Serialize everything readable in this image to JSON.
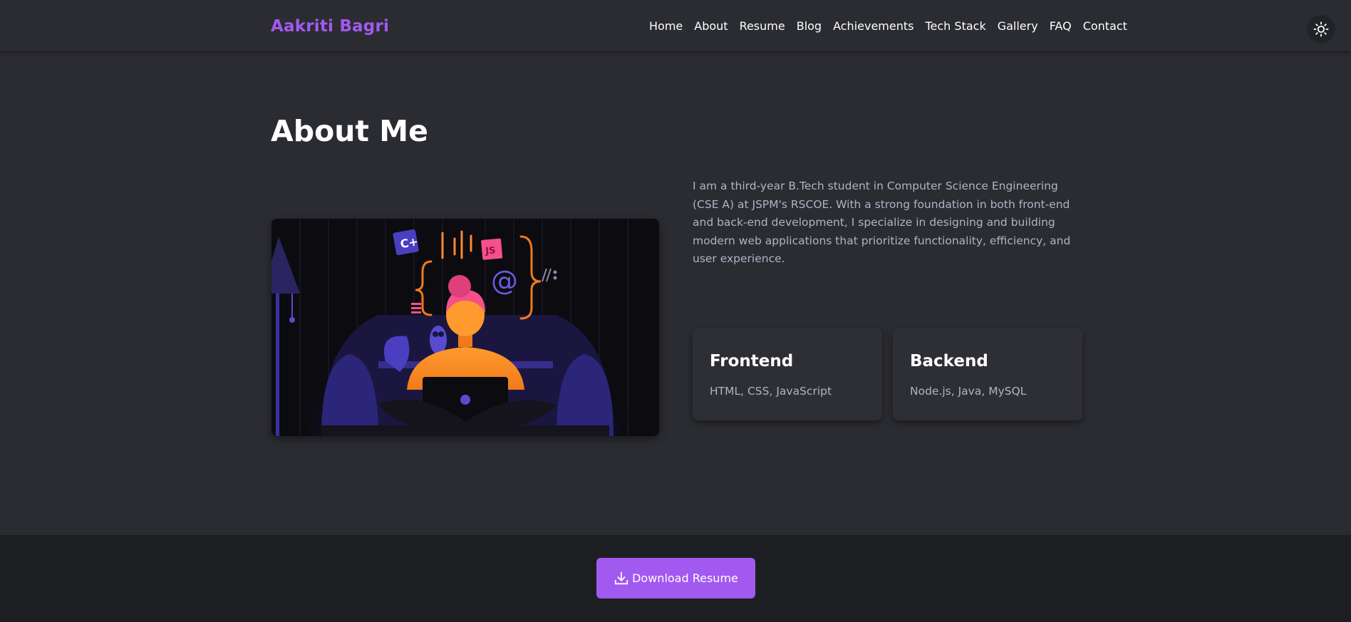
{
  "header": {
    "brand": "Aakriti Bagri",
    "nav": [
      "Home",
      "About",
      "Resume",
      "Blog",
      "Achievements",
      "Tech Stack",
      "Gallery",
      "FAQ",
      "Contact"
    ],
    "theme_icon": "sun-icon"
  },
  "about": {
    "title": "About Me",
    "bio": "I am a third-year B.Tech student in Computer Science Engineering (CSE A) at JSPM's RSCOE. With a strong foundation in both front-end and back-end development, I specialize in designing and building modern web applications that prioritize functionality, efficiency, and user experience.",
    "illustration_labels": {
      "cpp": "C+",
      "js": "JS",
      "at": "@"
    },
    "cards": [
      {
        "title": "Frontend",
        "text": "HTML, CSS, JavaScript"
      },
      {
        "title": "Backend",
        "text": "Node.js, Java, MySQL"
      }
    ]
  },
  "footer": {
    "download_label": "Download Resume",
    "download_icon": "download-icon"
  },
  "colors": {
    "accent": "#a259f0",
    "background": "#2b2c31",
    "footer_bg": "#1d1e22",
    "muted_text": "#aeb4c6"
  }
}
